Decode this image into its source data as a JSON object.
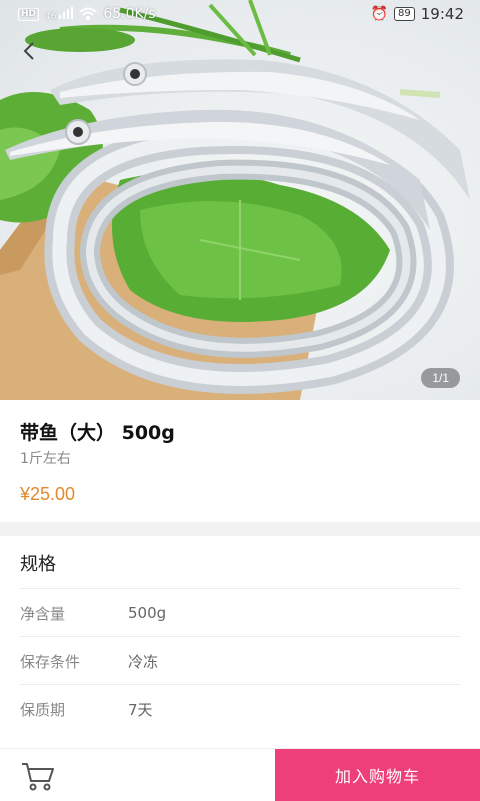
{
  "status_bar": {
    "network_badge": "HD",
    "signal_text": "46",
    "speed": "65.0K/s",
    "alarm_icon": "alarm-clock-icon",
    "battery": "89",
    "time": "19:42"
  },
  "header": {
    "back_icon": "chevron-left-icon"
  },
  "gallery": {
    "image_subject": "fish-photo",
    "counter": "1/1"
  },
  "product": {
    "name": "带鱼（大） 500g",
    "subtitle": "1斤左右",
    "price": "¥25.00"
  },
  "specs": {
    "title": "规格",
    "rows": [
      {
        "label": "净含量",
        "value": "500g"
      },
      {
        "label": "保存条件",
        "value": "冷冻"
      },
      {
        "label": "保质期",
        "value": "7天"
      }
    ]
  },
  "bottom_bar": {
    "cart_icon": "shopping-cart-icon",
    "add_to_cart_label": "加入购物车"
  },
  "colors": {
    "accent": "#ee3f7a",
    "price": "#e4892b"
  }
}
